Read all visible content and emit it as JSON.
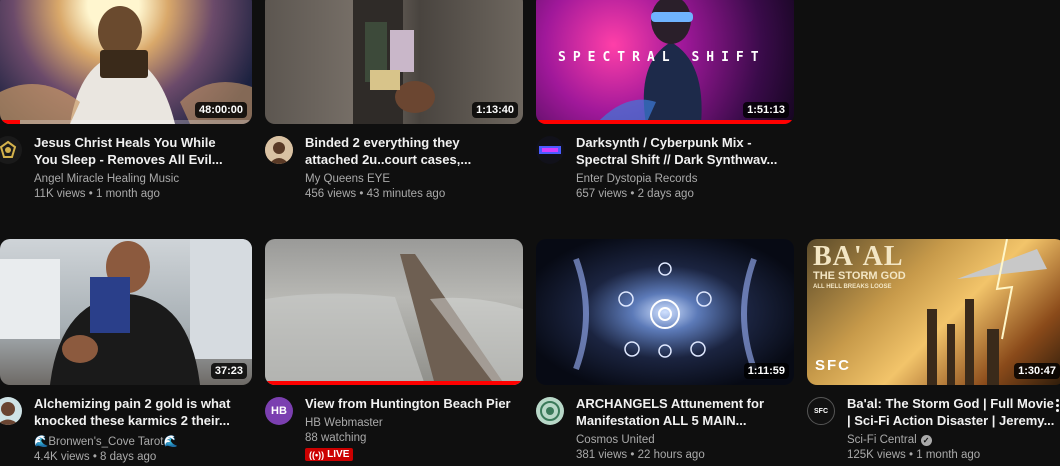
{
  "videos": [
    {
      "title_line1": "Jesus Christ Heals You While",
      "title_line2": "You Sleep - Removes All Evil...",
      "channel": "Angel Miracle Healing Music",
      "views": "11K views",
      "age": "1 month ago",
      "duration": "48:00:00",
      "watched_fraction": 0.08
    },
    {
      "title_line1": "Binded 2 everything they",
      "title_line2": "attached 2u..court cases,...",
      "channel": "My Queens EYE",
      "views": "456 views",
      "age": "43 minutes ago",
      "duration": "1:13:40"
    },
    {
      "title_line1": "Darksynth / Cyberpunk Mix -",
      "title_line2": "Spectral Shift // Dark Synthwav...",
      "channel": "Enter Dystopia Records",
      "views": "657 views",
      "age": "2 days ago",
      "duration": "1:51:13",
      "thumb_text": "SPECTRAL SHIFT",
      "watched_fraction": 1.0
    },
    {
      "title_line1": "Alchemizing pain 2 gold is what",
      "title_line2": "knocked these karmics 2 their...",
      "channel": "🌊Bronwen's_Cove Tarot🌊",
      "views": "4.4K views",
      "age": "8 days ago",
      "duration": "37:23"
    },
    {
      "title_line1": "View from Huntington Beach Pier",
      "title_line2": "",
      "channel": "HB Webmaster",
      "avatar_initials": "HB",
      "watching": "88 watching",
      "live_label": "LIVE",
      "watched_fraction": 1.0
    },
    {
      "title_line1": "ARCHANGELS Attunement for",
      "title_line2": "Manifestation ALL 5 MAIN...",
      "channel": "Cosmos United",
      "views": "381 views",
      "age": "22 hours ago",
      "duration": "1:11:59"
    },
    {
      "title_line1": "Ba'al: The Storm God | Full Movie",
      "title_line2": "| Sci-Fi Action Disaster | Jeremy...",
      "channel": "Sci-Fi Central",
      "views": "125K views",
      "age": "1 month ago",
      "duration": "1:30:47",
      "thumb_title": "BA'AL",
      "thumb_subtitle": "THE STORM GOD",
      "thumb_tagline": "ALL HELL BREAKS LOOSE",
      "thumb_badge": "SFC",
      "avatar_text": "SFC"
    }
  ],
  "separator": "•",
  "colors": {
    "background": "#0f0f0f",
    "live": "#cc0000",
    "progress": "#ff0000",
    "secondary_text": "#aaaaaa"
  }
}
